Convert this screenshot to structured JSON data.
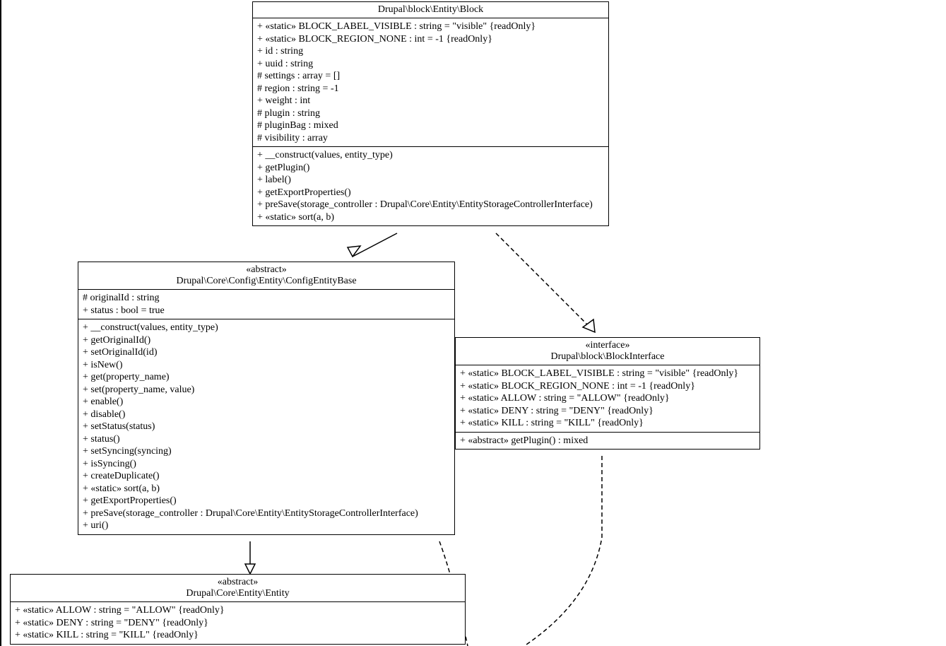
{
  "classes": {
    "block": {
      "title": "Drupal\\block\\Entity\\Block",
      "attrs": [
        "+ «static» BLOCK_LABEL_VISIBLE : string = \"visible\" {readOnly}",
        "+ «static» BLOCK_REGION_NONE : int = -1 {readOnly}",
        "+ id : string",
        "+ uuid : string",
        "# settings : array = []",
        "# region : string = -1",
        "+ weight : int",
        "# plugin : string",
        "# pluginBag : mixed",
        "# visibility : array"
      ],
      "ops": [
        "+ __construct(values, entity_type)",
        "+ getPlugin()",
        "+ label()",
        "+ getExportProperties()",
        "+ preSave(storage_controller : Drupal\\Core\\Entity\\EntityStorageControllerInterface)",
        "+ «static» sort(a, b)"
      ]
    },
    "configEntityBase": {
      "stereotype": "«abstract»",
      "title": "Drupal\\Core\\Config\\Entity\\ConfigEntityBase",
      "attrs": [
        "# originalId : string",
        "+ status : bool = true"
      ],
      "ops": [
        "+ __construct(values, entity_type)",
        "+ getOriginalId()",
        "+ setOriginalId(id)",
        "+ isNew()",
        "+ get(property_name)",
        "+ set(property_name, value)",
        "+ enable()",
        "+ disable()",
        "+ setStatus(status)",
        "+ status()",
        "+ setSyncing(syncing)",
        "+ isSyncing()",
        "+ createDuplicate()",
        "+ «static» sort(a, b)",
        "+ getExportProperties()",
        "+ preSave(storage_controller : Drupal\\Core\\Entity\\EntityStorageControllerInterface)",
        "+ uri()"
      ]
    },
    "blockInterface": {
      "stereotype": "«interface»",
      "title": "Drupal\\block\\BlockInterface",
      "attrs": [
        "+ «static» BLOCK_LABEL_VISIBLE : string = \"visible\" {readOnly}",
        "+ «static» BLOCK_REGION_NONE : int = -1 {readOnly}",
        "+ «static» ALLOW : string = \"ALLOW\" {readOnly}",
        "+ «static» DENY : string = \"DENY\" {readOnly}",
        "+ «static» KILL : string = \"KILL\" {readOnly}"
      ],
      "ops": [
        "+ «abstract» getPlugin() : mixed"
      ]
    },
    "entity": {
      "stereotype": "«abstract»",
      "title": "Drupal\\Core\\Entity\\Entity",
      "attrs": [
        "+ «static» ALLOW : string = \"ALLOW\" {readOnly}",
        "+ «static» DENY : string = \"DENY\" {readOnly}",
        "+ «static» KILL : string = \"KILL\" {readOnly}"
      ]
    }
  }
}
